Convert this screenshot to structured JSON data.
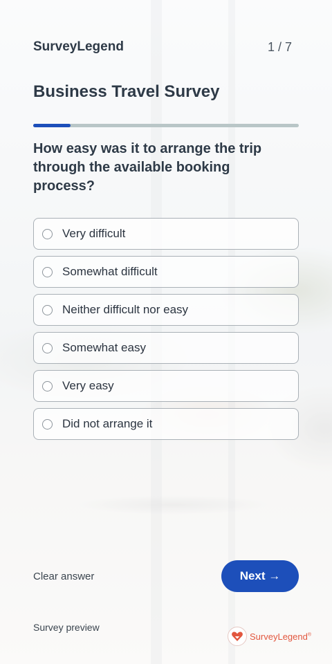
{
  "header": {
    "brand": "SurveyLegend",
    "counter": "1 / 7"
  },
  "survey": {
    "title": "Business Travel Survey",
    "progress": 0.14
  },
  "question": {
    "text": "How easy was it to arrange the trip through the available booking process?",
    "options": [
      {
        "label": "Very difficult"
      },
      {
        "label": "Somewhat difficult"
      },
      {
        "label": "Neither difficult nor easy"
      },
      {
        "label": "Somewhat easy"
      },
      {
        "label": "Very easy"
      },
      {
        "label": "Did not arrange it"
      }
    ]
  },
  "actions": {
    "clear_label": "Clear answer",
    "next_label": "Next →"
  },
  "footer": {
    "preview_label": "Survey preview",
    "logo_text": "SurveyLegend",
    "logo_mark": "®"
  },
  "colors": {
    "accent": "#1d4fba",
    "logo": "#e2573f",
    "track": "#b9c6c7"
  }
}
